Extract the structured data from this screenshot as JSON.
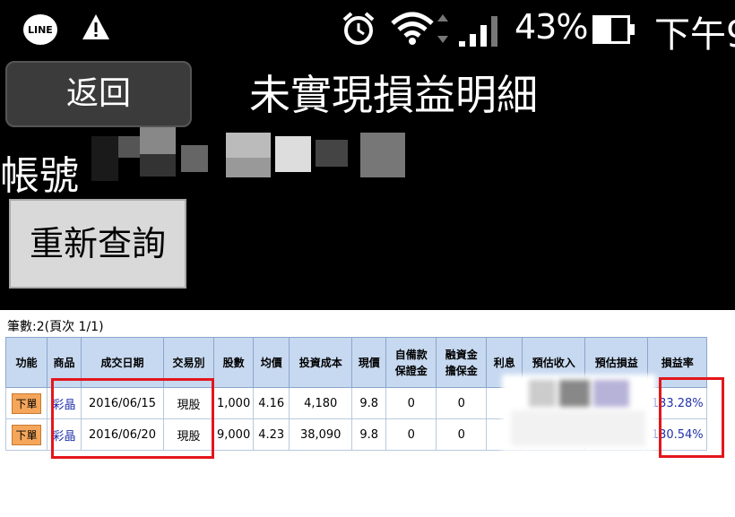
{
  "status_bar": {
    "line_text": "LINE",
    "battery": "43%",
    "time": "下午9"
  },
  "header": {
    "back_label": "返回",
    "title": "未實現損益明細"
  },
  "account": {
    "label": "帳號"
  },
  "requery_label": "重新查詢",
  "summary": "筆數:2(頁次 1/1)",
  "table": {
    "columns": [
      "功能",
      "商品",
      "成交日期",
      "交易別",
      "股數",
      "均價",
      "投資成本",
      "現價",
      "自備款\n保證金",
      "融資金\n擔保金",
      "利息",
      "預估收入",
      "預估損益",
      "損益率"
    ],
    "rows": [
      {
        "action": "下單",
        "product": "彩晶",
        "date": "2016/06/15",
        "trade_type": "現股",
        "shares": "1,000",
        "avg_price": "4.16",
        "cost": "4,180",
        "price": "9.8",
        "self_fund": "0",
        "margin_fund": "0",
        "interest": "",
        "est_income": "",
        "est_pl": "",
        "pl_rate": "133.28%"
      },
      {
        "action": "下單",
        "product": "彩晶",
        "date": "2016/06/20",
        "trade_type": "現股",
        "shares": "9,000",
        "avg_price": "4.23",
        "cost": "38,090",
        "price": "9.8",
        "self_fund": "0",
        "margin_fund": "0",
        "interest": "",
        "est_income": "",
        "est_pl": "",
        "pl_rate": "130.54%"
      }
    ]
  },
  "colors": {
    "header_bg": "#c7d9f0",
    "highlight": "#e3161b",
    "link": "#2233aa",
    "order_button": "#f5a65b"
  }
}
